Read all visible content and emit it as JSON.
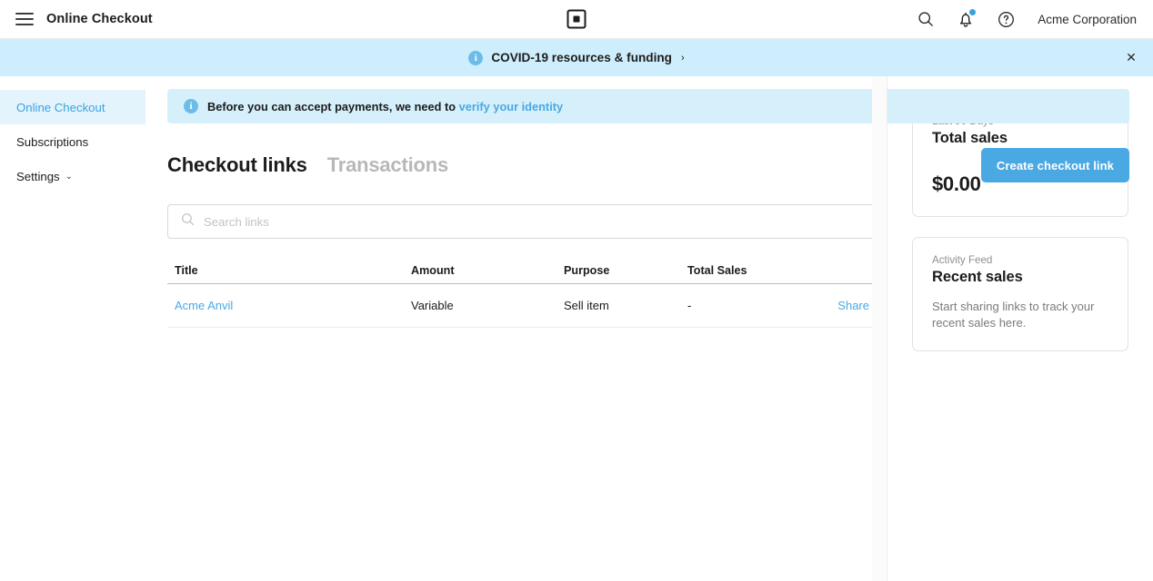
{
  "topbar": {
    "menu_icon": "hamburger-menu-icon",
    "app_title": "Online Checkout",
    "logo_icon": "square-logo-icon",
    "search_icon": "search-icon",
    "notifications_icon": "bell-icon",
    "help_icon": "help-circle-icon",
    "merchant_name": "Acme Corporation"
  },
  "covid_banner": {
    "info_icon": "info-circle-icon",
    "info_glyph": "i",
    "text": "COVID-19 resources & funding",
    "chevron": "›",
    "close_icon": "close-icon",
    "close_glyph": "✕",
    "bg_color": "#cfeefd"
  },
  "sidebar": {
    "items": [
      {
        "label": "Online Checkout",
        "active": true
      },
      {
        "label": "Subscriptions",
        "active": false
      },
      {
        "label": "Settings",
        "active": false,
        "chevron": "⌄"
      }
    ],
    "active_bg": "#e3f4fd",
    "active_color": "#3ca1e0"
  },
  "verify_banner": {
    "info_icon": "info-circle-icon",
    "info_glyph": "i",
    "text": "Before you can accept payments, we need to ",
    "link_text": "verify your identity",
    "bg_color": "#d6f0fb"
  },
  "tabs": [
    {
      "label": "Checkout links",
      "active": true
    },
    {
      "label": "Transactions",
      "active": false
    }
  ],
  "actions": {
    "create_link_label": "Create checkout link",
    "accent_color": "#4aa8e3"
  },
  "search": {
    "icon": "search-icon",
    "value": "",
    "placeholder": "Search links"
  },
  "table": {
    "columns": [
      "Title",
      "Amount",
      "Purpose",
      "Total Sales",
      ""
    ],
    "rows": [
      {
        "title": "Acme Anvil",
        "amount": "Variable",
        "purpose": "Sell item",
        "total_sales": "-",
        "share_label": "Share"
      }
    ]
  },
  "right_rail": {
    "cards": [
      {
        "eyebrow": "Last 90 Days",
        "title": "Total sales",
        "amount": "$0.00"
      },
      {
        "eyebrow": "Activity Feed",
        "title": "Recent sales",
        "body": "Start sharing links to track your recent sales here."
      }
    ]
  }
}
